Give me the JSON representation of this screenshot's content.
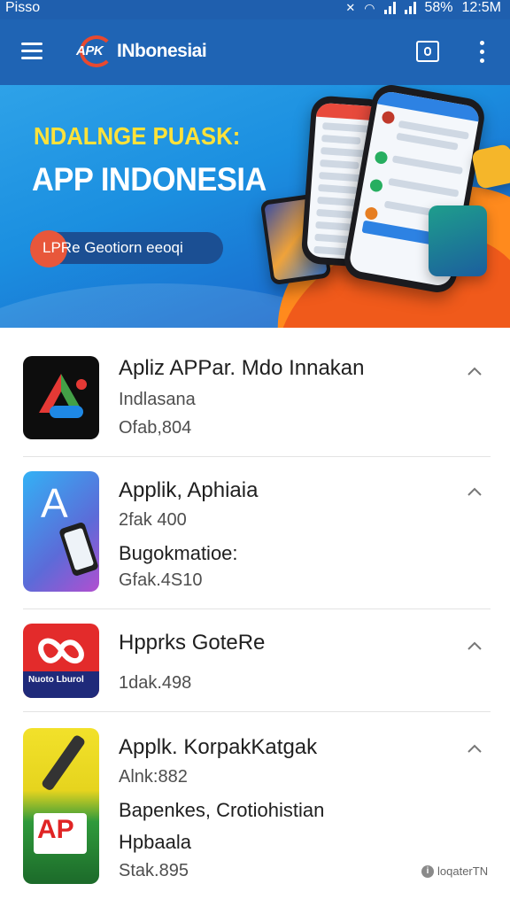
{
  "status_bar": {
    "left_text": "Pisso",
    "battery": "58%",
    "time": "12:5M"
  },
  "app_bar": {
    "logo_mark": "APK",
    "logo_text": "INbonesiai"
  },
  "banner": {
    "eyebrow": "NDALNGE PUASK:",
    "title": "APP INDONESIA",
    "cta_label": "LPRe Geotiorn eeoqi",
    "colors": {
      "yellow": "#ffe23a",
      "orange": "#f05a1b",
      "blue": "#1b8fe0"
    }
  },
  "apps": [
    {
      "title": "Apliz APPar. Mdo Innakan",
      "lines": [
        "Indlasana",
        "Ofab,804"
      ]
    },
    {
      "title": "Applik, Aphiaia",
      "lines": [
        "2fak 400",
        "Bugokmatioe:",
        "Gfak.4S10"
      ]
    },
    {
      "title": "Hpprks GoteRe",
      "icon_label": "Nuoto Lburol",
      "lines": [
        "1dak.498"
      ]
    },
    {
      "title": "Applk. KorpakKatgak",
      "icon_label": "AP",
      "lines": [
        "Alnk:882",
        "Bapenkes, Crotiohistian",
        "Hpbaala",
        "Stak.895"
      ]
    }
  ],
  "footer_badge": "loqaterTN"
}
